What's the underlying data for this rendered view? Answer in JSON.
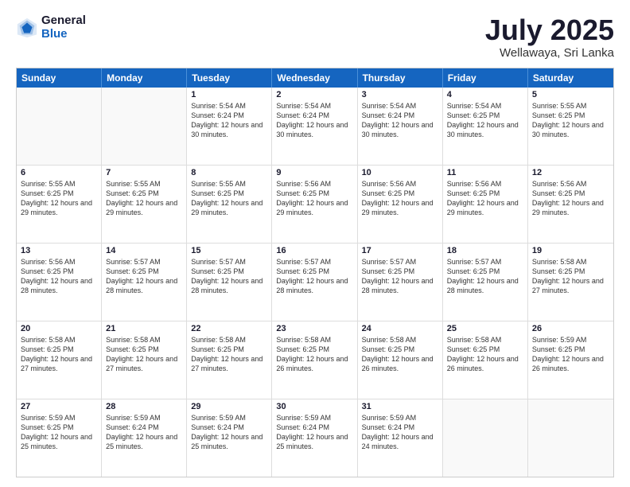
{
  "logo": {
    "general": "General",
    "blue": "Blue"
  },
  "header": {
    "month": "July 2025",
    "location": "Wellawaya, Sri Lanka"
  },
  "days": [
    "Sunday",
    "Monday",
    "Tuesday",
    "Wednesday",
    "Thursday",
    "Friday",
    "Saturday"
  ],
  "weeks": [
    [
      {
        "day": "",
        "info": ""
      },
      {
        "day": "",
        "info": ""
      },
      {
        "day": "1",
        "sunrise": "Sunrise: 5:54 AM",
        "sunset": "Sunset: 6:24 PM",
        "daylight": "Daylight: 12 hours and 30 minutes."
      },
      {
        "day": "2",
        "sunrise": "Sunrise: 5:54 AM",
        "sunset": "Sunset: 6:24 PM",
        "daylight": "Daylight: 12 hours and 30 minutes."
      },
      {
        "day": "3",
        "sunrise": "Sunrise: 5:54 AM",
        "sunset": "Sunset: 6:24 PM",
        "daylight": "Daylight: 12 hours and 30 minutes."
      },
      {
        "day": "4",
        "sunrise": "Sunrise: 5:54 AM",
        "sunset": "Sunset: 6:25 PM",
        "daylight": "Daylight: 12 hours and 30 minutes."
      },
      {
        "day": "5",
        "sunrise": "Sunrise: 5:55 AM",
        "sunset": "Sunset: 6:25 PM",
        "daylight": "Daylight: 12 hours and 30 minutes."
      }
    ],
    [
      {
        "day": "6",
        "sunrise": "Sunrise: 5:55 AM",
        "sunset": "Sunset: 6:25 PM",
        "daylight": "Daylight: 12 hours and 29 minutes."
      },
      {
        "day": "7",
        "sunrise": "Sunrise: 5:55 AM",
        "sunset": "Sunset: 6:25 PM",
        "daylight": "Daylight: 12 hours and 29 minutes."
      },
      {
        "day": "8",
        "sunrise": "Sunrise: 5:55 AM",
        "sunset": "Sunset: 6:25 PM",
        "daylight": "Daylight: 12 hours and 29 minutes."
      },
      {
        "day": "9",
        "sunrise": "Sunrise: 5:56 AM",
        "sunset": "Sunset: 6:25 PM",
        "daylight": "Daylight: 12 hours and 29 minutes."
      },
      {
        "day": "10",
        "sunrise": "Sunrise: 5:56 AM",
        "sunset": "Sunset: 6:25 PM",
        "daylight": "Daylight: 12 hours and 29 minutes."
      },
      {
        "day": "11",
        "sunrise": "Sunrise: 5:56 AM",
        "sunset": "Sunset: 6:25 PM",
        "daylight": "Daylight: 12 hours and 29 minutes."
      },
      {
        "day": "12",
        "sunrise": "Sunrise: 5:56 AM",
        "sunset": "Sunset: 6:25 PM",
        "daylight": "Daylight: 12 hours and 29 minutes."
      }
    ],
    [
      {
        "day": "13",
        "sunrise": "Sunrise: 5:56 AM",
        "sunset": "Sunset: 6:25 PM",
        "daylight": "Daylight: 12 hours and 28 minutes."
      },
      {
        "day": "14",
        "sunrise": "Sunrise: 5:57 AM",
        "sunset": "Sunset: 6:25 PM",
        "daylight": "Daylight: 12 hours and 28 minutes."
      },
      {
        "day": "15",
        "sunrise": "Sunrise: 5:57 AM",
        "sunset": "Sunset: 6:25 PM",
        "daylight": "Daylight: 12 hours and 28 minutes."
      },
      {
        "day": "16",
        "sunrise": "Sunrise: 5:57 AM",
        "sunset": "Sunset: 6:25 PM",
        "daylight": "Daylight: 12 hours and 28 minutes."
      },
      {
        "day": "17",
        "sunrise": "Sunrise: 5:57 AM",
        "sunset": "Sunset: 6:25 PM",
        "daylight": "Daylight: 12 hours and 28 minutes."
      },
      {
        "day": "18",
        "sunrise": "Sunrise: 5:57 AM",
        "sunset": "Sunset: 6:25 PM",
        "daylight": "Daylight: 12 hours and 28 minutes."
      },
      {
        "day": "19",
        "sunrise": "Sunrise: 5:58 AM",
        "sunset": "Sunset: 6:25 PM",
        "daylight": "Daylight: 12 hours and 27 minutes."
      }
    ],
    [
      {
        "day": "20",
        "sunrise": "Sunrise: 5:58 AM",
        "sunset": "Sunset: 6:25 PM",
        "daylight": "Daylight: 12 hours and 27 minutes."
      },
      {
        "day": "21",
        "sunrise": "Sunrise: 5:58 AM",
        "sunset": "Sunset: 6:25 PM",
        "daylight": "Daylight: 12 hours and 27 minutes."
      },
      {
        "day": "22",
        "sunrise": "Sunrise: 5:58 AM",
        "sunset": "Sunset: 6:25 PM",
        "daylight": "Daylight: 12 hours and 27 minutes."
      },
      {
        "day": "23",
        "sunrise": "Sunrise: 5:58 AM",
        "sunset": "Sunset: 6:25 PM",
        "daylight": "Daylight: 12 hours and 26 minutes."
      },
      {
        "day": "24",
        "sunrise": "Sunrise: 5:58 AM",
        "sunset": "Sunset: 6:25 PM",
        "daylight": "Daylight: 12 hours and 26 minutes."
      },
      {
        "day": "25",
        "sunrise": "Sunrise: 5:58 AM",
        "sunset": "Sunset: 6:25 PM",
        "daylight": "Daylight: 12 hours and 26 minutes."
      },
      {
        "day": "26",
        "sunrise": "Sunrise: 5:59 AM",
        "sunset": "Sunset: 6:25 PM",
        "daylight": "Daylight: 12 hours and 26 minutes."
      }
    ],
    [
      {
        "day": "27",
        "sunrise": "Sunrise: 5:59 AM",
        "sunset": "Sunset: 6:25 PM",
        "daylight": "Daylight: 12 hours and 25 minutes."
      },
      {
        "day": "28",
        "sunrise": "Sunrise: 5:59 AM",
        "sunset": "Sunset: 6:24 PM",
        "daylight": "Daylight: 12 hours and 25 minutes."
      },
      {
        "day": "29",
        "sunrise": "Sunrise: 5:59 AM",
        "sunset": "Sunset: 6:24 PM",
        "daylight": "Daylight: 12 hours and 25 minutes."
      },
      {
        "day": "30",
        "sunrise": "Sunrise: 5:59 AM",
        "sunset": "Sunset: 6:24 PM",
        "daylight": "Daylight: 12 hours and 25 minutes."
      },
      {
        "day": "31",
        "sunrise": "Sunrise: 5:59 AM",
        "sunset": "Sunset: 6:24 PM",
        "daylight": "Daylight: 12 hours and 24 minutes."
      },
      {
        "day": "",
        "info": ""
      },
      {
        "day": "",
        "info": ""
      }
    ]
  ]
}
